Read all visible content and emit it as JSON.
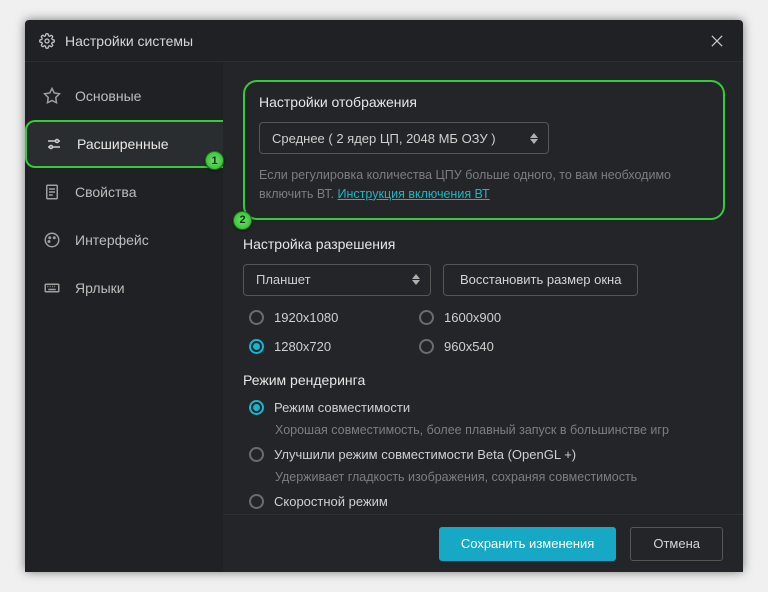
{
  "window": {
    "title": "Настройки системы"
  },
  "sidebar": {
    "items": [
      {
        "label": "Основные"
      },
      {
        "label": "Расширенные"
      },
      {
        "label": "Свойства"
      },
      {
        "label": "Интерфейс"
      },
      {
        "label": "Ярлыки"
      }
    ]
  },
  "badges": {
    "one": "1",
    "two": "2"
  },
  "display": {
    "title": "Настройки отображения",
    "select_value": "Среднее ( 2 ядер ЦП, 2048 МБ ОЗУ )",
    "hint_prefix": "Если регулировка количества ЦПУ больше одного, то вам необходимо включить ВТ. ",
    "hint_link": "Инструкция включения ВТ"
  },
  "resolution": {
    "title": "Настройка разрешения",
    "select_value": "Планшет",
    "reset_btn": "Восстановить размер окна",
    "options": [
      {
        "label": "1920x1080",
        "selected": false
      },
      {
        "label": "1600x900",
        "selected": false
      },
      {
        "label": "1280x720",
        "selected": true
      },
      {
        "label": "960x540",
        "selected": false
      }
    ]
  },
  "rendering": {
    "title": "Режим рендеринга",
    "modes": [
      {
        "label": "Режим совместимости",
        "selected": true,
        "desc": "Хорошая совместимость, более плавный запуск в большинстве игр"
      },
      {
        "label": "Улучшили режим совместимости Beta (OpenGL +)",
        "selected": false,
        "desc": "Удерживает гладкость изображения, сохраняя совместимость"
      },
      {
        "label": "Скоростной режим",
        "selected": false
      }
    ]
  },
  "footer": {
    "save": "Сохранить изменения",
    "cancel": "Отмена"
  }
}
